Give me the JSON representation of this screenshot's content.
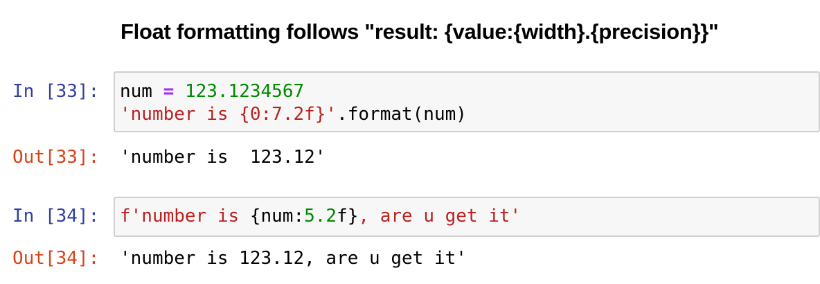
{
  "heading": "Float formatting follows \"result: {value:{width}.{precision}}\"",
  "cells": [
    {
      "in_prompt": "In [33]:",
      "code_line1": {
        "var": "num",
        "op": " = ",
        "num": "123.1234567"
      },
      "code_line2": {
        "str": "'number is {0:7.2f}'",
        "rest": ".format(num)"
      },
      "out_prompt": "Out[33]:",
      "output": "'number is  123.12'"
    },
    {
      "in_prompt": "In [34]:",
      "code_line1": {
        "str_a": "f'number is ",
        "brace_open": "{num:",
        "num": "5.2",
        "brace_close": "f}",
        "str_b": ", are u get it'"
      },
      "out_prompt": "Out[34]:",
      "output": "'number is 123.12, are u get it'"
    }
  ],
  "colors": {
    "in_prompt": "#303f9f",
    "out_prompt": "#d84315",
    "string": "#ba2121",
    "number": "#008800",
    "operator": "#aa22ff",
    "cell_background": "#f7f7f7",
    "cell_border": "#cfcfcf"
  }
}
